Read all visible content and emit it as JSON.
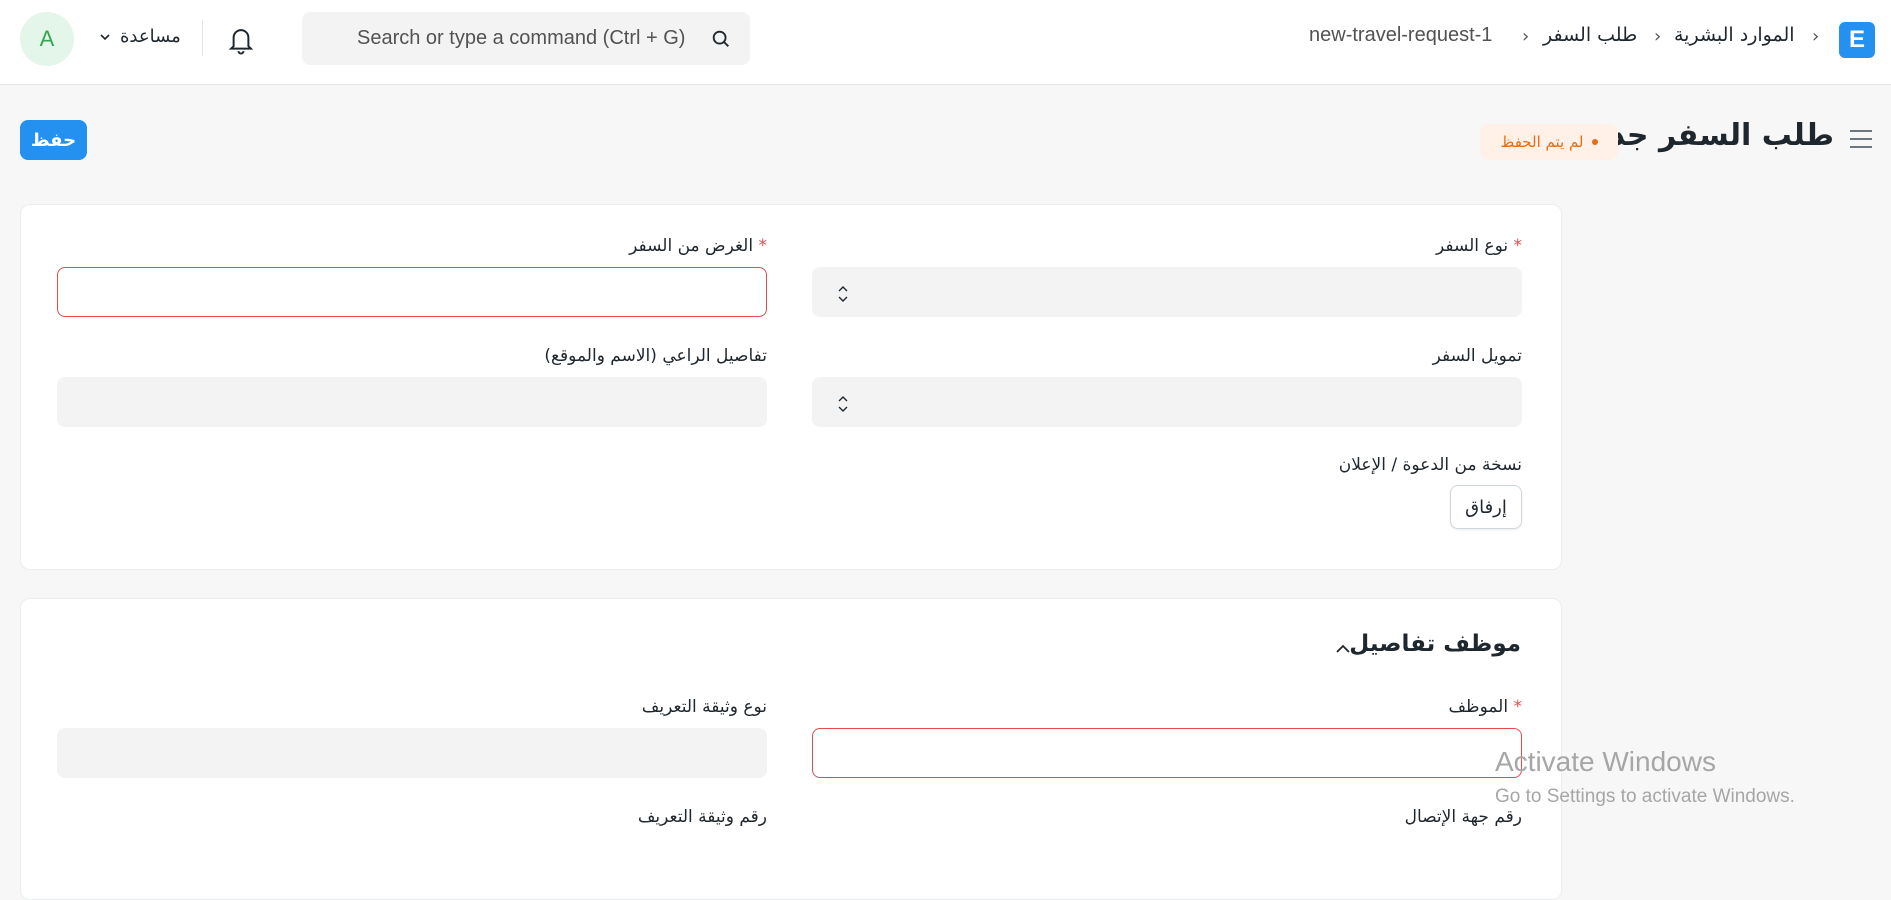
{
  "navbar": {
    "logo_letter": "E",
    "breadcrumbs": [
      "الموارد البشرية",
      "طلب السفر",
      "new-travel-request-1"
    ],
    "search_placeholder": "Search or type a command (Ctrl + G)",
    "help_label": "مساعدة",
    "avatar_initial": "A"
  },
  "page": {
    "title": "طلب السفر جديد",
    "indicator": "لم يتم الحفظ",
    "save_label": "حفظ"
  },
  "form": {
    "travel_type_label": "نوع السفر",
    "purpose_label": "الغرض من السفر",
    "travel_funding_label": "تمويل السفر",
    "sponsor_details_label": "تفاصيل الراعي (الاسم والموقع)",
    "invitation_copy_label": "نسخة من الدعوة / الإعلان",
    "attach_label": "إرفاق",
    "required_mark": "*"
  },
  "employee_section": {
    "title": "موظف تفاصيل",
    "employee_label": "الموظف",
    "id_type_label": "نوع وثيقة التعريف",
    "contact_number_label": "رقم جهة الإتصال",
    "id_number_label": "رقم وثيقة التعريف"
  },
  "watermark": {
    "line1": "Activate Windows",
    "line2": "Go to Settings to activate Windows."
  },
  "colors": {
    "primary": "#2490ef",
    "error_border": "#e24c4c",
    "indicator_text": "#e86c13",
    "indicator_bg": "#fff1e7"
  }
}
